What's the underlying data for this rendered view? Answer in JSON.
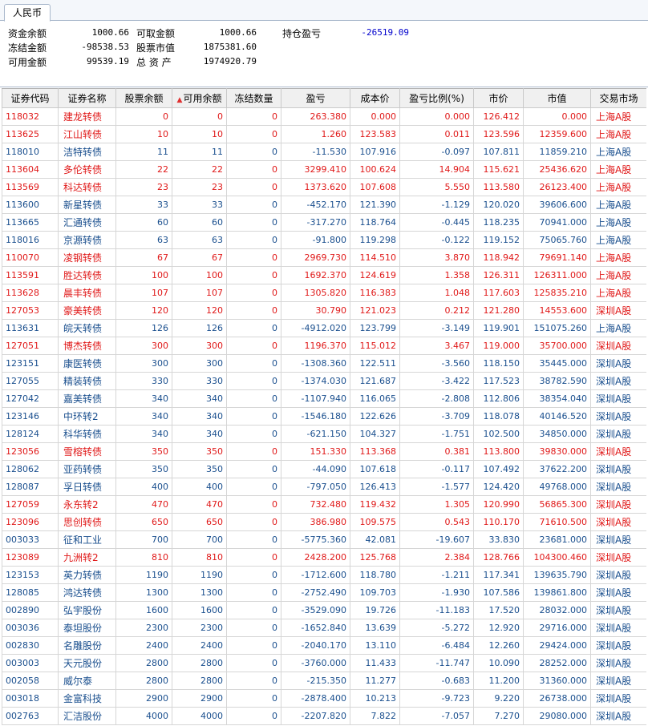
{
  "tab": {
    "label": "人民币"
  },
  "summary": {
    "fund_balance_label": "资金余额",
    "fund_balance": "1000.66",
    "withdrawable_label": "可取金额",
    "withdrawable": "1000.66",
    "position_pnl_label": "持仓盈亏",
    "position_pnl": "-26519.09",
    "frozen_label": "冻结金额",
    "frozen": "-98538.53",
    "stock_value_label": "股票市值",
    "stock_value": "1875381.60",
    "available_label": "可用金额",
    "available": "99539.19",
    "total_assets_label": "总 资 产",
    "total_assets": "1974920.79"
  },
  "colors": {
    "profit": "#e01818",
    "loss": "#1a4f8e",
    "sort_arrow": "#e03030"
  },
  "table": {
    "sorted_column_index": 3,
    "sort_direction": "ascending",
    "sort_icon": "sort-asc-icon",
    "headers": [
      "证券代码",
      "证券名称",
      "股票余额",
      "可用余额",
      "冻结数量",
      "盈亏",
      "成本价",
      "盈亏比例(%)",
      "市价",
      "市值",
      "交易市场"
    ],
    "rows": [
      {
        "code": "118032",
        "name": "建龙转债",
        "balance": "0",
        "available": "0",
        "frozen": "0",
        "pnl": "263.380",
        "cost": "0.000",
        "pnl_pct": "0.000",
        "price": "126.412",
        "value": "0.000",
        "market": "上海A股",
        "trend": "up"
      },
      {
        "code": "113625",
        "name": "江山转债",
        "balance": "10",
        "available": "10",
        "frozen": "0",
        "pnl": "1.260",
        "cost": "123.583",
        "pnl_pct": "0.011",
        "price": "123.596",
        "value": "12359.600",
        "market": "上海A股",
        "trend": "up"
      },
      {
        "code": "118010",
        "name": "洁特转债",
        "balance": "11",
        "available": "11",
        "frozen": "0",
        "pnl": "-11.530",
        "cost": "107.916",
        "pnl_pct": "-0.097",
        "price": "107.811",
        "value": "11859.210",
        "market": "上海A股",
        "trend": "down"
      },
      {
        "code": "113604",
        "name": "多伦转债",
        "balance": "22",
        "available": "22",
        "frozen": "0",
        "pnl": "3299.410",
        "cost": "100.624",
        "pnl_pct": "14.904",
        "price": "115.621",
        "value": "25436.620",
        "market": "上海A股",
        "trend": "up"
      },
      {
        "code": "113569",
        "name": "科达转债",
        "balance": "23",
        "available": "23",
        "frozen": "0",
        "pnl": "1373.620",
        "cost": "107.608",
        "pnl_pct": "5.550",
        "price": "113.580",
        "value": "26123.400",
        "market": "上海A股",
        "trend": "up"
      },
      {
        "code": "113600",
        "name": "新星转债",
        "balance": "33",
        "available": "33",
        "frozen": "0",
        "pnl": "-452.170",
        "cost": "121.390",
        "pnl_pct": "-1.129",
        "price": "120.020",
        "value": "39606.600",
        "market": "上海A股",
        "trend": "down"
      },
      {
        "code": "113665",
        "name": "汇通转债",
        "balance": "60",
        "available": "60",
        "frozen": "0",
        "pnl": "-317.270",
        "cost": "118.764",
        "pnl_pct": "-0.445",
        "price": "118.235",
        "value": "70941.000",
        "market": "上海A股",
        "trend": "down"
      },
      {
        "code": "118016",
        "name": "京源转债",
        "balance": "63",
        "available": "63",
        "frozen": "0",
        "pnl": "-91.800",
        "cost": "119.298",
        "pnl_pct": "-0.122",
        "price": "119.152",
        "value": "75065.760",
        "market": "上海A股",
        "trend": "down"
      },
      {
        "code": "110070",
        "name": "凌钢转债",
        "balance": "67",
        "available": "67",
        "frozen": "0",
        "pnl": "2969.730",
        "cost": "114.510",
        "pnl_pct": "3.870",
        "price": "118.942",
        "value": "79691.140",
        "market": "上海A股",
        "trend": "up"
      },
      {
        "code": "113591",
        "name": "胜达转债",
        "balance": "100",
        "available": "100",
        "frozen": "0",
        "pnl": "1692.370",
        "cost": "124.619",
        "pnl_pct": "1.358",
        "price": "126.311",
        "value": "126311.000",
        "market": "上海A股",
        "trend": "up"
      },
      {
        "code": "113628",
        "name": "晨丰转债",
        "balance": "107",
        "available": "107",
        "frozen": "0",
        "pnl": "1305.820",
        "cost": "116.383",
        "pnl_pct": "1.048",
        "price": "117.603",
        "value": "125835.210",
        "market": "上海A股",
        "trend": "up"
      },
      {
        "code": "127053",
        "name": "豪美转债",
        "balance": "120",
        "available": "120",
        "frozen": "0",
        "pnl": "30.790",
        "cost": "121.023",
        "pnl_pct": "0.212",
        "price": "121.280",
        "value": "14553.600",
        "market": "深圳A股",
        "trend": "up"
      },
      {
        "code": "113631",
        "name": "皖天转债",
        "balance": "126",
        "available": "126",
        "frozen": "0",
        "pnl": "-4912.020",
        "cost": "123.799",
        "pnl_pct": "-3.149",
        "price": "119.901",
        "value": "151075.260",
        "market": "上海A股",
        "trend": "down"
      },
      {
        "code": "127051",
        "name": "博杰转债",
        "balance": "300",
        "available": "300",
        "frozen": "0",
        "pnl": "1196.370",
        "cost": "115.012",
        "pnl_pct": "3.467",
        "price": "119.000",
        "value": "35700.000",
        "market": "深圳A股",
        "trend": "up"
      },
      {
        "code": "123151",
        "name": "康医转债",
        "balance": "300",
        "available": "300",
        "frozen": "0",
        "pnl": "-1308.360",
        "cost": "122.511",
        "pnl_pct": "-3.560",
        "price": "118.150",
        "value": "35445.000",
        "market": "深圳A股",
        "trend": "down"
      },
      {
        "code": "127055",
        "name": "精装转债",
        "balance": "330",
        "available": "330",
        "frozen": "0",
        "pnl": "-1374.030",
        "cost": "121.687",
        "pnl_pct": "-3.422",
        "price": "117.523",
        "value": "38782.590",
        "market": "深圳A股",
        "trend": "down"
      },
      {
        "code": "127042",
        "name": "嘉美转债",
        "balance": "340",
        "available": "340",
        "frozen": "0",
        "pnl": "-1107.940",
        "cost": "116.065",
        "pnl_pct": "-2.808",
        "price": "112.806",
        "value": "38354.040",
        "market": "深圳A股",
        "trend": "down"
      },
      {
        "code": "123146",
        "name": "中环转2",
        "balance": "340",
        "available": "340",
        "frozen": "0",
        "pnl": "-1546.180",
        "cost": "122.626",
        "pnl_pct": "-3.709",
        "price": "118.078",
        "value": "40146.520",
        "market": "深圳A股",
        "trend": "down"
      },
      {
        "code": "128124",
        "name": "科华转债",
        "balance": "340",
        "available": "340",
        "frozen": "0",
        "pnl": "-621.150",
        "cost": "104.327",
        "pnl_pct": "-1.751",
        "price": "102.500",
        "value": "34850.000",
        "market": "深圳A股",
        "trend": "down"
      },
      {
        "code": "123056",
        "name": "雪榕转债",
        "balance": "350",
        "available": "350",
        "frozen": "0",
        "pnl": "151.330",
        "cost": "113.368",
        "pnl_pct": "0.381",
        "price": "113.800",
        "value": "39830.000",
        "market": "深圳A股",
        "trend": "up"
      },
      {
        "code": "128062",
        "name": "亚药转债",
        "balance": "350",
        "available": "350",
        "frozen": "0",
        "pnl": "-44.090",
        "cost": "107.618",
        "pnl_pct": "-0.117",
        "price": "107.492",
        "value": "37622.200",
        "market": "深圳A股",
        "trend": "down"
      },
      {
        "code": "128087",
        "name": "孚日转债",
        "balance": "400",
        "available": "400",
        "frozen": "0",
        "pnl": "-797.050",
        "cost": "126.413",
        "pnl_pct": "-1.577",
        "price": "124.420",
        "value": "49768.000",
        "market": "深圳A股",
        "trend": "down"
      },
      {
        "code": "127059",
        "name": "永东转2",
        "balance": "470",
        "available": "470",
        "frozen": "0",
        "pnl": "732.480",
        "cost": "119.432",
        "pnl_pct": "1.305",
        "price": "120.990",
        "value": "56865.300",
        "market": "深圳A股",
        "trend": "up"
      },
      {
        "code": "123096",
        "name": "思创转债",
        "balance": "650",
        "available": "650",
        "frozen": "0",
        "pnl": "386.980",
        "cost": "109.575",
        "pnl_pct": "0.543",
        "price": "110.170",
        "value": "71610.500",
        "market": "深圳A股",
        "trend": "up"
      },
      {
        "code": "003033",
        "name": "征和工业",
        "balance": "700",
        "available": "700",
        "frozen": "0",
        "pnl": "-5775.360",
        "cost": "42.081",
        "pnl_pct": "-19.607",
        "price": "33.830",
        "value": "23681.000",
        "market": "深圳A股",
        "trend": "down"
      },
      {
        "code": "123089",
        "name": "九洲转2",
        "balance": "810",
        "available": "810",
        "frozen": "0",
        "pnl": "2428.200",
        "cost": "125.768",
        "pnl_pct": "2.384",
        "price": "128.766",
        "value": "104300.460",
        "market": "深圳A股",
        "trend": "up"
      },
      {
        "code": "123153",
        "name": "英力转债",
        "balance": "1190",
        "available": "1190",
        "frozen": "0",
        "pnl": "-1712.600",
        "cost": "118.780",
        "pnl_pct": "-1.211",
        "price": "117.341",
        "value": "139635.790",
        "market": "深圳A股",
        "trend": "down"
      },
      {
        "code": "128085",
        "name": "鸿达转债",
        "balance": "1300",
        "available": "1300",
        "frozen": "0",
        "pnl": "-2752.490",
        "cost": "109.703",
        "pnl_pct": "-1.930",
        "price": "107.586",
        "value": "139861.800",
        "market": "深圳A股",
        "trend": "down"
      },
      {
        "code": "002890",
        "name": "弘宇股份",
        "balance": "1600",
        "available": "1600",
        "frozen": "0",
        "pnl": "-3529.090",
        "cost": "19.726",
        "pnl_pct": "-11.183",
        "price": "17.520",
        "value": "28032.000",
        "market": "深圳A股",
        "trend": "down"
      },
      {
        "code": "003036",
        "name": "泰坦股份",
        "balance": "2300",
        "available": "2300",
        "frozen": "0",
        "pnl": "-1652.840",
        "cost": "13.639",
        "pnl_pct": "-5.272",
        "price": "12.920",
        "value": "29716.000",
        "market": "深圳A股",
        "trend": "down"
      },
      {
        "code": "002830",
        "name": "名雕股份",
        "balance": "2400",
        "available": "2400",
        "frozen": "0",
        "pnl": "-2040.170",
        "cost": "13.110",
        "pnl_pct": "-6.484",
        "price": "12.260",
        "value": "29424.000",
        "market": "深圳A股",
        "trend": "down"
      },
      {
        "code": "003003",
        "name": "天元股份",
        "balance": "2800",
        "available": "2800",
        "frozen": "0",
        "pnl": "-3760.000",
        "cost": "11.433",
        "pnl_pct": "-11.747",
        "price": "10.090",
        "value": "28252.000",
        "market": "深圳A股",
        "trend": "down"
      },
      {
        "code": "002058",
        "name": "威尔泰",
        "balance": "2800",
        "available": "2800",
        "frozen": "0",
        "pnl": "-215.350",
        "cost": "11.277",
        "pnl_pct": "-0.683",
        "price": "11.200",
        "value": "31360.000",
        "market": "深圳A股",
        "trend": "down"
      },
      {
        "code": "003018",
        "name": "金富科技",
        "balance": "2900",
        "available": "2900",
        "frozen": "0",
        "pnl": "-2878.400",
        "cost": "10.213",
        "pnl_pct": "-9.723",
        "price": "9.220",
        "value": "26738.000",
        "market": "深圳A股",
        "trend": "down"
      },
      {
        "code": "002763",
        "name": "汇洁股份",
        "balance": "4000",
        "available": "4000",
        "frozen": "0",
        "pnl": "-2207.820",
        "cost": "7.822",
        "pnl_pct": "-7.057",
        "price": "7.270",
        "value": "29080.000",
        "market": "深圳A股",
        "trend": "down"
      }
    ]
  }
}
